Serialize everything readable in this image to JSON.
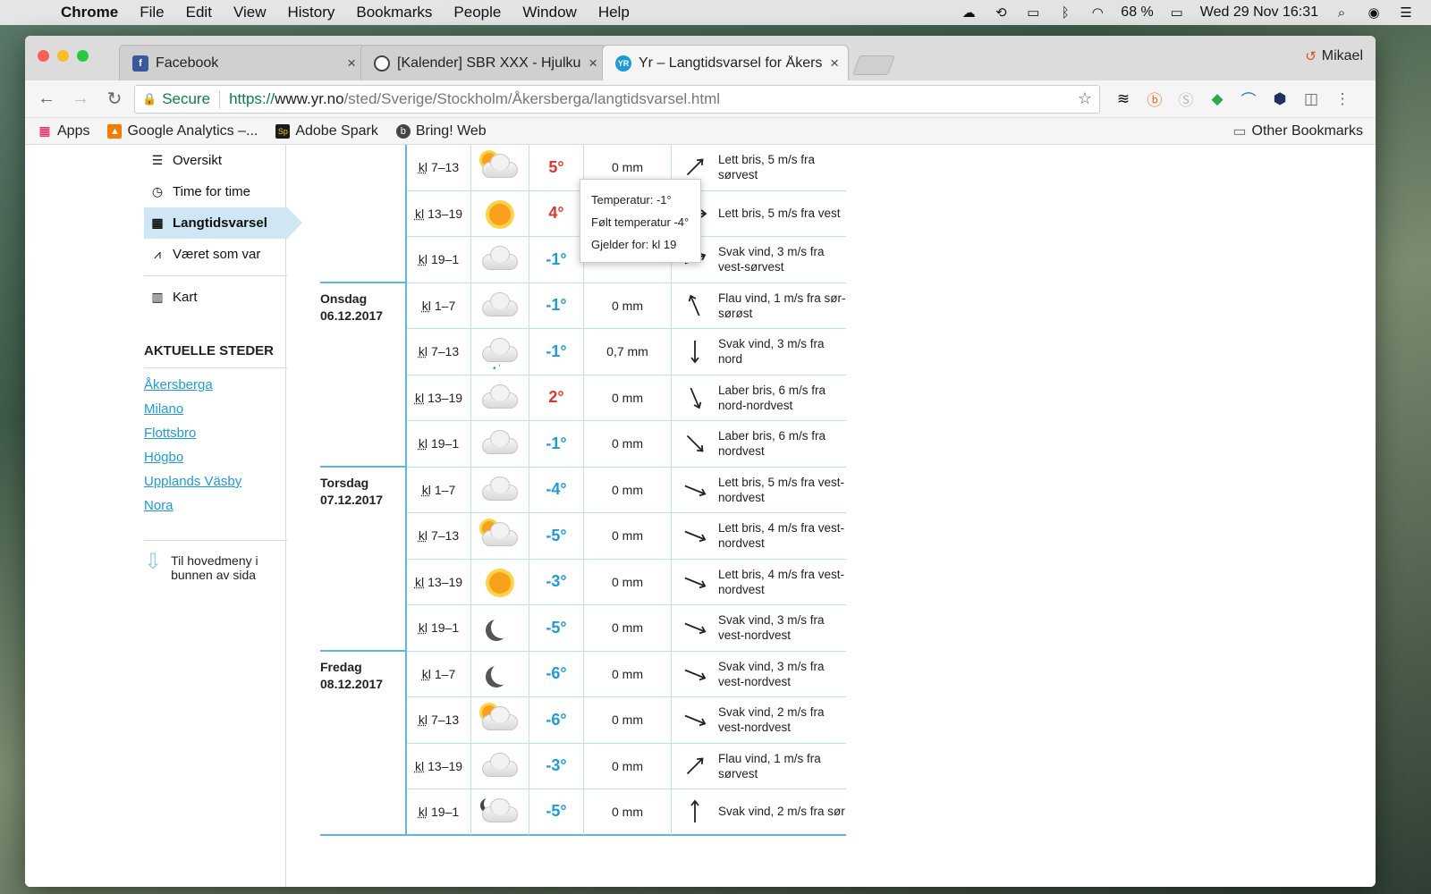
{
  "menubar": {
    "app": "Chrome",
    "items": [
      "File",
      "Edit",
      "View",
      "History",
      "Bookmarks",
      "People",
      "Window",
      "Help"
    ],
    "battery": "68 %",
    "clock": "Wed 29 Nov  16:31"
  },
  "tabs": [
    {
      "title": "Facebook",
      "icon": "facebook-icon"
    },
    {
      "title": "[Kalender] SBR XXX - Hjulkul i",
      "icon": "sbr-icon"
    },
    {
      "title": "Yr – Langtidsvarsel for Åkersbe",
      "icon": "yr-icon"
    }
  ],
  "profile": "Mikael",
  "address": {
    "secure_label": "Secure",
    "scheme": "https://",
    "host": "www.yr.no",
    "path": "/sted/Sverige/Stockholm/Åkersberga/langtidsvarsel.html"
  },
  "bookmarks": {
    "items": [
      "Apps",
      "Google Analytics –...",
      "Adobe Spark",
      "Bring! Web"
    ],
    "other": "Other Bookmarks"
  },
  "sidebar": {
    "nav": [
      {
        "label": "Oversikt",
        "icon": "list-icon"
      },
      {
        "label": "Time for time",
        "icon": "clock-icon"
      },
      {
        "label": "Langtidsvarsel",
        "icon": "calendar-icon"
      },
      {
        "label": "Været som var",
        "icon": "graph-icon"
      },
      {
        "label": "Kart",
        "icon": "map-icon"
      }
    ],
    "aktuelle_title": "AKTUELLE STEDER",
    "places": [
      "Åkersberga",
      "Milano",
      "Flottsbro",
      "Högbo",
      "Upplands Väsby",
      "Nora"
    ],
    "to_menu": "Til hovedmeny i bunnen av sida"
  },
  "tooltip": {
    "line1": "Temperatur: -1°",
    "line2": "Følt temperatur -4°",
    "line3": "Gjelder for: kl 19"
  },
  "forecast": {
    "kl": "kl",
    "rows": [
      {
        "day": "",
        "date": "",
        "time": "7–13",
        "symbol": "partly-cloudy",
        "temp": "5°",
        "temp_class": "warm",
        "prec": "0 mm",
        "wind_dir_deg": 225,
        "wind": "Lett bris, 5 m/s fra sørvest"
      },
      {
        "day": "",
        "date": "",
        "time": "13–19",
        "symbol": "sun",
        "temp": "4°",
        "temp_class": "warm",
        "prec": "",
        "wind_dir_deg": 270,
        "wind": "Lett bris, 5 m/s fra vest"
      },
      {
        "day": "",
        "date": "",
        "time": "19–1",
        "symbol": "cloud",
        "temp": "-1°",
        "temp_class": "cold",
        "prec": "",
        "wind_dir_deg": 247,
        "wind": "Svak vind, 3 m/s fra vest-sørvest",
        "end": true
      },
      {
        "day": "Onsdag",
        "date": "06.12.2017",
        "time": "1–7",
        "symbol": "cloud",
        "temp": "-1°",
        "temp_class": "cold",
        "prec": "0 mm",
        "wind_dir_deg": 157,
        "wind": "Flau vind, 1 m/s fra sør-sørøst"
      },
      {
        "day": "",
        "date": "",
        "time": "7–13",
        "symbol": "cloud-snow",
        "temp": "-1°",
        "temp_class": "cold",
        "prec": "0,7 mm",
        "wind_dir_deg": 0,
        "wind": "Svak vind, 3 m/s fra nord"
      },
      {
        "day": "",
        "date": "",
        "time": "13–19",
        "symbol": "cloud",
        "temp": "2°",
        "temp_class": "warm",
        "prec": "0 mm",
        "wind_dir_deg": 337,
        "wind": "Laber bris, 6 m/s fra nord-nordvest"
      },
      {
        "day": "",
        "date": "",
        "time": "19–1",
        "symbol": "cloud",
        "temp": "-1°",
        "temp_class": "cold",
        "prec": "0 mm",
        "wind_dir_deg": 315,
        "wind": "Laber bris, 6 m/s fra nordvest",
        "end": true
      },
      {
        "day": "Torsdag",
        "date": "07.12.2017",
        "time": "1–7",
        "symbol": "cloud",
        "temp": "-4°",
        "temp_class": "cold",
        "prec": "0 mm",
        "wind_dir_deg": 292,
        "wind": "Lett bris, 5 m/s fra vest-nordvest"
      },
      {
        "day": "",
        "date": "",
        "time": "7–13",
        "symbol": "partly-cloudy",
        "temp": "-5°",
        "temp_class": "cold",
        "prec": "0 mm",
        "wind_dir_deg": 292,
        "wind": "Lett bris, 4 m/s fra vest-nordvest"
      },
      {
        "day": "",
        "date": "",
        "time": "13–19",
        "symbol": "sun",
        "temp": "-3°",
        "temp_class": "cold",
        "prec": "0 mm",
        "wind_dir_deg": 292,
        "wind": "Lett bris, 4 m/s fra vest-nordvest"
      },
      {
        "day": "",
        "date": "",
        "time": "19–1",
        "symbol": "moon",
        "temp": "-5°",
        "temp_class": "cold",
        "prec": "0 mm",
        "wind_dir_deg": 292,
        "wind": "Svak vind, 3 m/s fra vest-nordvest",
        "end": true
      },
      {
        "day": "Fredag",
        "date": "08.12.2017",
        "time": "1–7",
        "symbol": "moon",
        "temp": "-6°",
        "temp_class": "cold",
        "prec": "0 mm",
        "wind_dir_deg": 292,
        "wind": "Svak vind, 3 m/s fra vest-nordvest"
      },
      {
        "day": "",
        "date": "",
        "time": "7–13",
        "symbol": "partly-cloudy",
        "temp": "-6°",
        "temp_class": "cold",
        "prec": "0 mm",
        "wind_dir_deg": 292,
        "wind": "Svak vind, 2 m/s fra vest-nordvest"
      },
      {
        "day": "",
        "date": "",
        "time": "13–19",
        "symbol": "cloud",
        "temp": "-3°",
        "temp_class": "cold",
        "prec": "0 mm",
        "wind_dir_deg": 225,
        "wind": "Flau vind, 1 m/s fra sørvest"
      },
      {
        "day": "",
        "date": "",
        "time": "19–1",
        "symbol": "moon-cloud",
        "temp": "-5°",
        "temp_class": "cold",
        "prec": "0 mm",
        "wind_dir_deg": 180,
        "wind": "Svak vind, 2 m/s fra sør",
        "end": true
      }
    ]
  }
}
